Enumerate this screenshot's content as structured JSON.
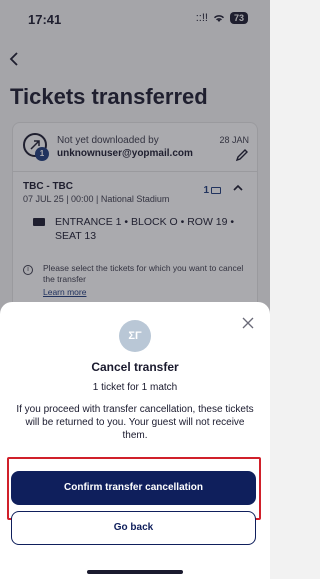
{
  "status_bar": {
    "time": "17:41",
    "signal": "::!!",
    "battery": "73"
  },
  "page": {
    "title": "Tickets transferred"
  },
  "ticket_card": {
    "recipient_status": "Not yet downloaded by",
    "recipient_email": "unknownuser@yopmail.com",
    "recipient_badge": "1",
    "date": "28 JAN",
    "match_title": "TBC - TBC",
    "match_details": "07 JUL 25 | 00:00 | National Stadium",
    "ticket_count": "1",
    "seat_text": "ENTRANCE 1 • BLOCK O • ROW 19 • SEAT 13",
    "info_text": "Please select the tickets for which you want to cancel the transfer",
    "learn_more": "Learn more"
  },
  "dialog": {
    "icon_text": "ΣΓ",
    "title": "Cancel transfer",
    "subtitle": "1 ticket for 1 match",
    "body": "If you proceed with transfer cancellation, these tickets will be returned to you. Your guest will not receive them.",
    "confirm_label": "Confirm transfer cancellation",
    "go_back_label": "Go back"
  },
  "colors": {
    "primary": "#0f1f5c",
    "highlight": "#d0202a",
    "overlay": "rgba(40,40,50,0.38)"
  },
  "icons": [
    "back-arrow-icon",
    "transfer-icon",
    "edit-pencil-icon",
    "chevron-up-icon",
    "ticket-icon",
    "info-icon",
    "close-icon",
    "wifi-icon"
  ]
}
